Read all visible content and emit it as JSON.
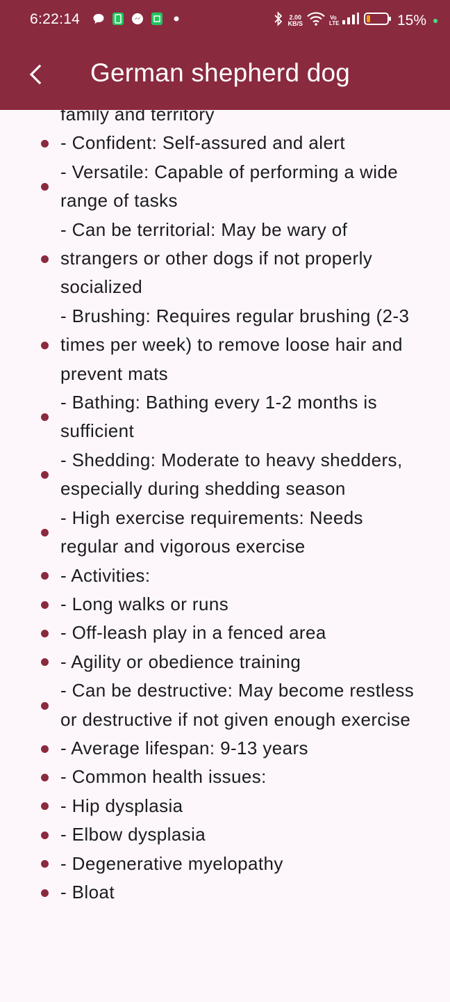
{
  "status_bar": {
    "time": "6:22:14",
    "net_speed_value": "2.00",
    "net_speed_unit": "KB/S",
    "volte_top": "Vo",
    "volte_bottom": "LTE",
    "battery_percent": "15%",
    "colors": {
      "bar": "#8a2a3f",
      "battery_fill": "#f59e0b",
      "indicator": "#4ade80"
    }
  },
  "app_bar": {
    "title": "German shepherd dog",
    "back_icon": "arrow-back-icon"
  },
  "list": {
    "clipped_top": "family and territory",
    "items": [
      "- Confident: Self-assured and alert",
      "- Versatile: Capable of performing a wide range of tasks",
      "- Can be territorial: May be wary of strangers or other dogs if not properly socialized",
      "- Brushing: Requires regular brushing (2-3 times per week) to remove loose hair and prevent mats",
      "- Bathing: Bathing every 1-2 months is sufficient",
      "- Shedding: Moderate to heavy shedders, especially during shedding season",
      "- High exercise requirements: Needs regular and vigorous exercise",
      "- Activities:",
      "- Long walks or runs",
      "- Off-leash play in a fenced area",
      "- Agility or obedience training",
      "- Can be destructive: May become restless or destructive if not given enough exercise",
      "- Average lifespan: 9-13 years",
      "- Common health issues:",
      "- Hip dysplasia",
      "- Elbow dysplasia",
      "- Degenerative myelopathy",
      "- Bloat"
    ]
  }
}
